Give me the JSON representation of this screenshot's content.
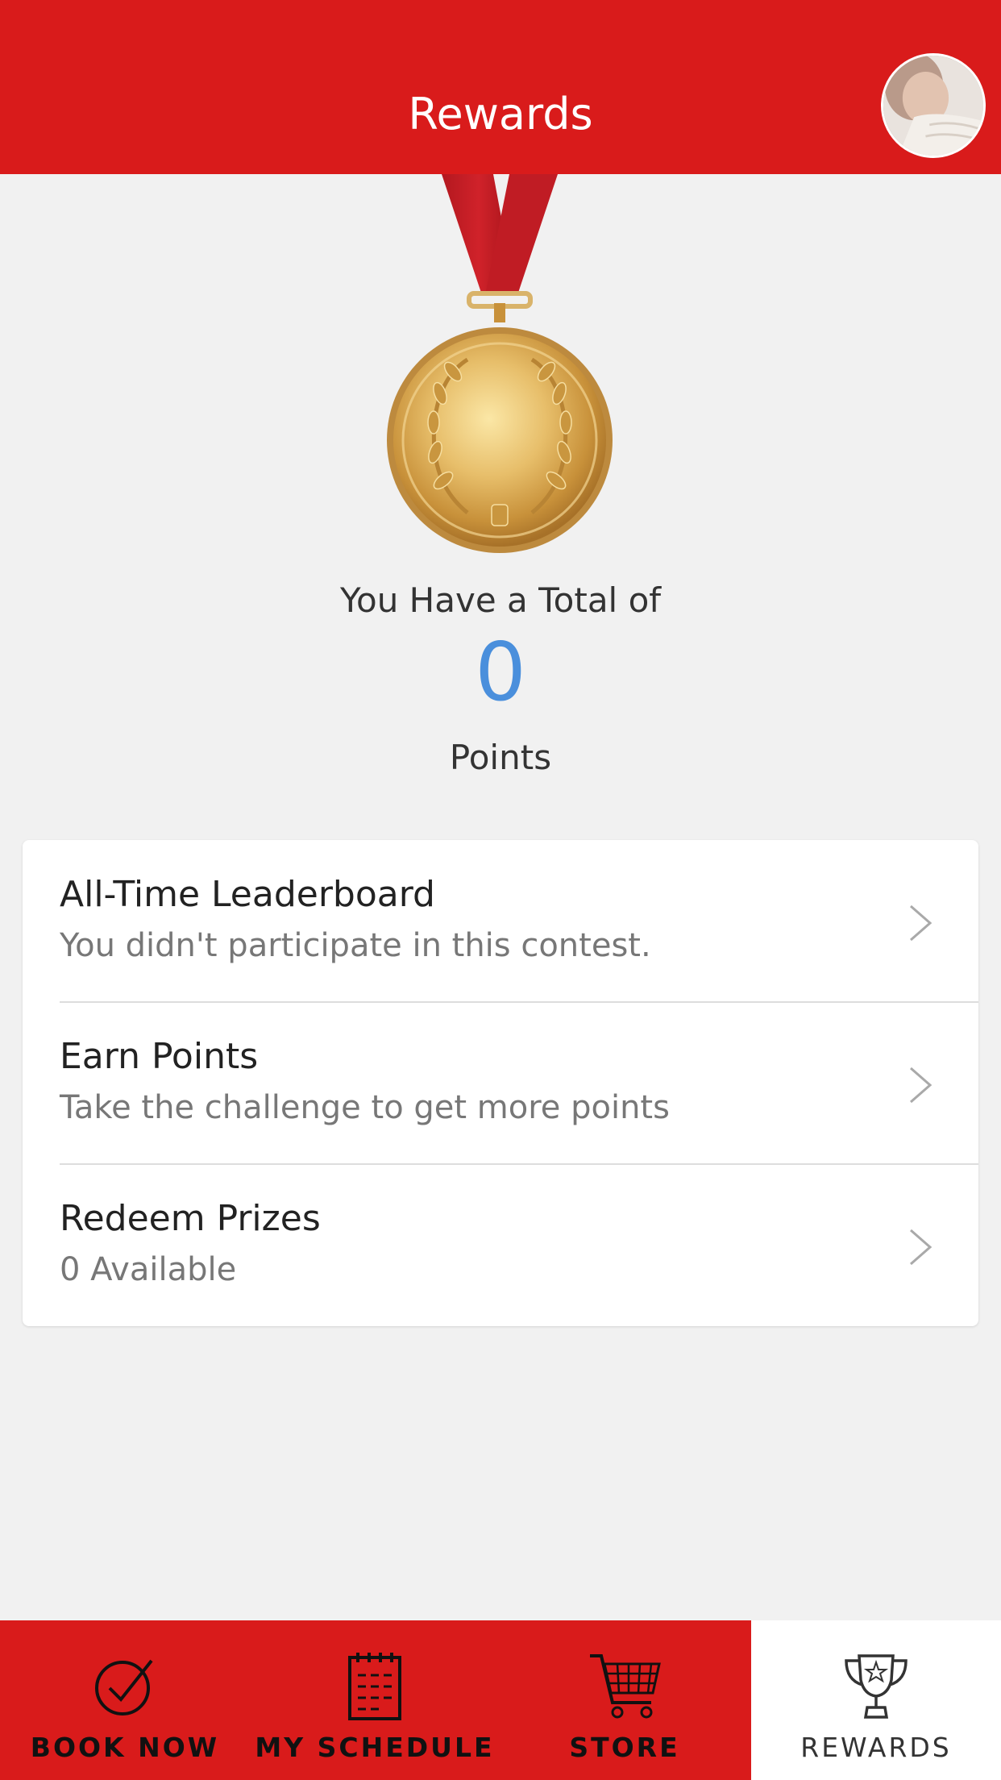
{
  "header": {
    "title": "Rewards"
  },
  "summary": {
    "total_label": "You Have a Total of",
    "points": "0",
    "points_label": "Points"
  },
  "menu": [
    {
      "title": "All-Time Leaderboard",
      "subtitle": "You didn't participate in this contest."
    },
    {
      "title": "Earn Points",
      "subtitle": "Take the challenge to get more points"
    },
    {
      "title": "Redeem Prizes",
      "subtitle": "0 Available"
    }
  ],
  "tabs": [
    {
      "label": "BOOK NOW",
      "icon": "check-circle-icon"
    },
    {
      "label": "MY SCHEDULE",
      "icon": "calendar-icon"
    },
    {
      "label": "STORE",
      "icon": "cart-icon"
    },
    {
      "label": "REWARDS",
      "icon": "trophy-icon",
      "active": true
    }
  ],
  "colors": {
    "brand_red": "#d91b1b",
    "points_blue": "#4a8fdc",
    "background": "#f1f1f1"
  }
}
